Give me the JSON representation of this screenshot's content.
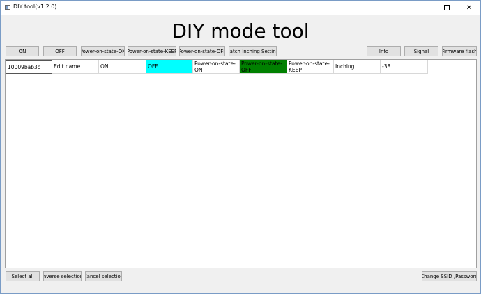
{
  "window": {
    "title": "DIY tool(v1.2.0)"
  },
  "heading": "DIY mode tool",
  "toolbar": {
    "on": "ON",
    "off": "OFF",
    "power_on_state_on": "Power-on-state-ON",
    "power_on_state_keep": "Power-on-state-KEEP",
    "power_on_state_off": "Power-on-state-OFF",
    "batch_inching": "Batch Inching Setting",
    "info": "Info",
    "signal": "Signal",
    "firmware_flash": "Firmware flash"
  },
  "device_row": {
    "device_id": "10009bab3c",
    "edit_name": "Edit name",
    "on": "ON",
    "off": "OFF",
    "power_on_state_on": "Power-on-state-ON",
    "power_on_state_off": "Power-on-state-OFF",
    "power_on_state_keep": "Power-on-state-KEEP",
    "inching": "Inching",
    "signal": "-38"
  },
  "bottom": {
    "select_all": "Select all",
    "inverse_selection": "Inverse selection",
    "cancel_selection": "Cancel selection",
    "change_ssid": "Change SSID ,Password"
  },
  "colors": {
    "off_highlight": "#00ffff",
    "power_off_highlight": "#008000"
  }
}
